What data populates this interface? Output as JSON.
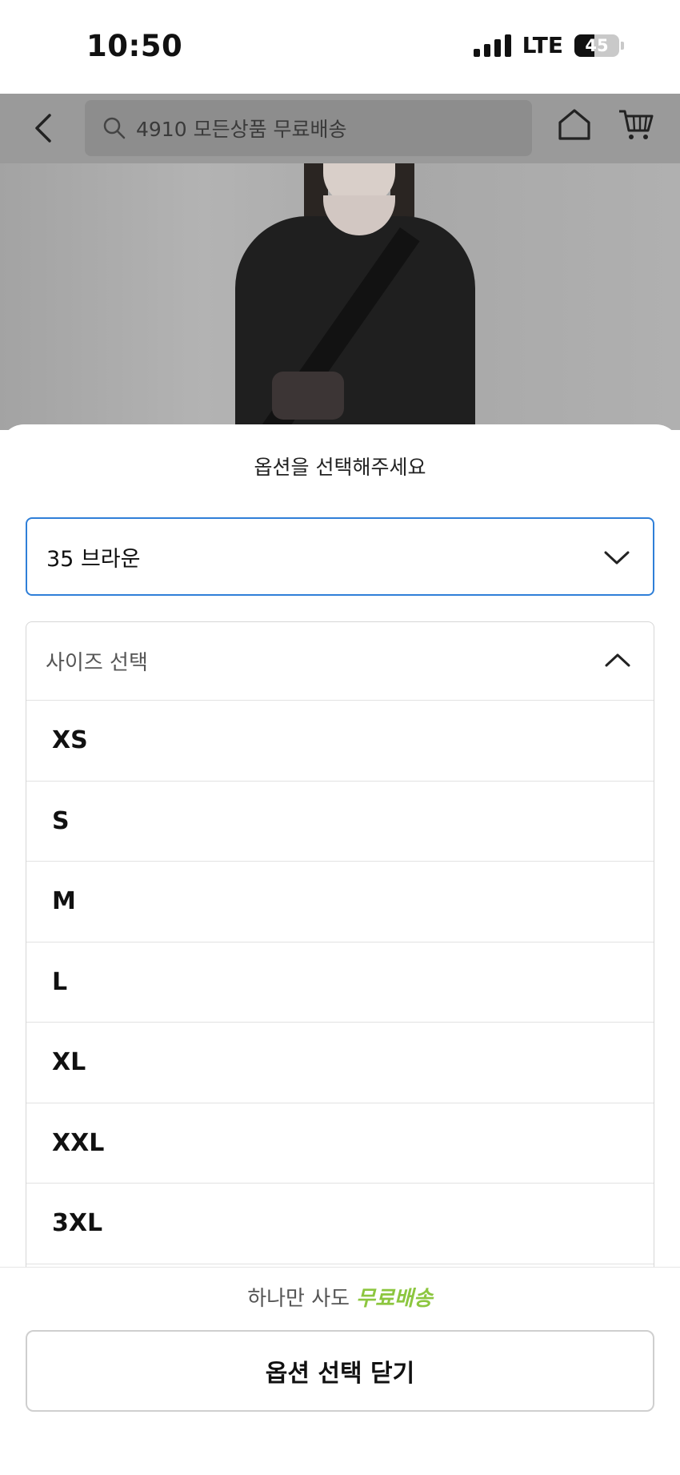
{
  "status_bar": {
    "time": "10:50",
    "network": "LTE",
    "battery": "45",
    "battery_level": 0.45
  },
  "header": {
    "search_text": "4910 모든상품 무료배송",
    "icons": [
      "back-arrow-icon",
      "search-icon",
      "home-icon",
      "cart-icon"
    ]
  },
  "sheet": {
    "title": "옵션을 선택해주세요",
    "color_select": {
      "value": "35 브라운"
    },
    "size_select": {
      "label": "사이즈 선택",
      "options": [
        "XS",
        "S",
        "M",
        "L",
        "XL",
        "XXL",
        "3XL"
      ]
    }
  },
  "footer": {
    "promo_text": "하나만 사도",
    "promo_emphasis": "무료배송",
    "promo_color": "#8cc63f",
    "close_button": "옵션 선택 닫기"
  },
  "colors": {
    "accent_border": "#2f7fd8",
    "dim_overlay": "#9a9a9a"
  }
}
